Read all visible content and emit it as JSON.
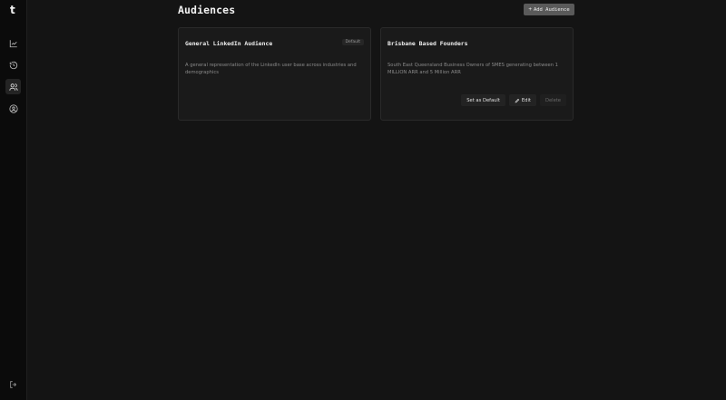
{
  "app": {
    "logo_text": "t"
  },
  "page": {
    "title": "Audiences",
    "add_button_label": "Add Audience"
  },
  "nav": {
    "items": [
      {
        "icon": "line-chart-icon"
      },
      {
        "icon": "history-icon"
      },
      {
        "icon": "users-icon",
        "active": true
      },
      {
        "icon": "user-circle-icon"
      }
    ],
    "logout_icon": "logout-icon"
  },
  "audiences": [
    {
      "name": "General LinkedIn Audience",
      "badge": "Default",
      "description": "A general representation of the LinkedIn user base across industries and demographics"
    },
    {
      "name": "Brisbane Based Founders",
      "description": "South East Queensland Business Owners of SMES generating between 1 MILLION ARR and 5 Million ARR",
      "actions": {
        "set_default": "Set as Default",
        "edit": "Edit",
        "delete": "Delete"
      }
    }
  ]
}
